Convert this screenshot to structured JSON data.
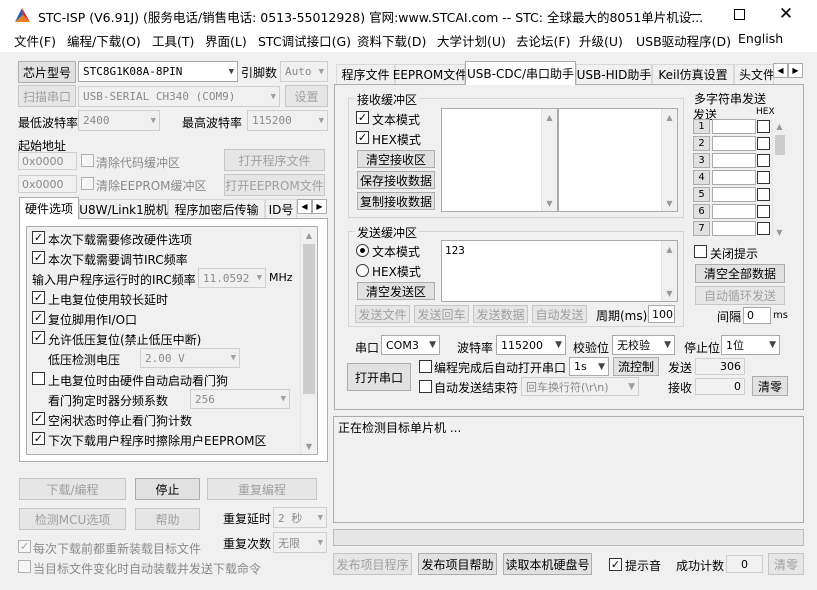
{
  "titlebar": {
    "title": "STC-ISP (V6.91J) (服务电话/销售电话: 0513-55012928) 官网:www.STCAI.com  -- STC: 全球最大的8051单片机设..."
  },
  "menu": [
    "文件(F)",
    "编程/下载(O)",
    "工具(T)",
    "界面(L)",
    "STC调试接口(G)",
    "资料下载(D)",
    "大学计划(U)",
    "去论坛(F)",
    "升级(U)",
    "USB驱动程序(D)",
    "English"
  ],
  "left": {
    "chip_button": "芯片型号",
    "chip_value": "STC8G1K08A-8PIN",
    "pin_label": "引脚数",
    "pin_value": "Auto",
    "scan_button": "扫描串口",
    "port_value": "USB-SERIAL CH340 (COM9)",
    "settings_button": "设置",
    "min_baud_label": "最低波特率",
    "min_baud_value": "2400",
    "max_baud_label": "最高波特率",
    "max_baud_value": "115200",
    "start_addr_label": "起始地址",
    "code_addr": "0x0000",
    "clear_code": "清除代码缓冲区",
    "open_prog": "打开程序文件",
    "eeprom_addr": "0x0000",
    "clear_eeprom": "清除EEPROM缓冲区",
    "open_eeprom": "打开EEPROM文件",
    "tabs": [
      "硬件选项",
      "U8W/Link1脱机",
      "程序加密后传输",
      "ID号"
    ],
    "options": {
      "opt1": "本次下载需要修改硬件选项",
      "opt2": "本次下载需要调节IRC频率",
      "irc_label": "输入用户程序运行时的IRC频率",
      "irc_value": "11.0592",
      "irc_unit": "MHz",
      "opt3": "上电复位使用较长延时",
      "opt4": "复位脚用作I/O口",
      "opt5": "允许低压复位(禁止低压中断)",
      "lv_label": "低压检测电压",
      "lv_value": "2.00 V",
      "opt6": "上电复位时由硬件自动启动看门狗",
      "wdt_label": "看门狗定时器分频系数",
      "wdt_value": "256",
      "opt7": "空闲状态时停止看门狗计数",
      "opt8": "下次下载用户程序时擦除用户EEPROM区"
    },
    "download_button": "下载/编程",
    "stop_button": "停止",
    "reprogram_button": "重复编程",
    "check_mcu_button": "检测MCU选项",
    "help_button": "帮助",
    "repeat_delay_label": "重复延时",
    "repeat_delay_value": "2 秒",
    "repeat_count_label": "重复次数",
    "repeat_count_value": "无限",
    "reload_before": "每次下载前都重新装载目标文件",
    "auto_reload": "当目标文件变化时自动装载并发送下载命令"
  },
  "right": {
    "tabs": [
      "程序文件",
      "EEPROM文件",
      "USB-CDC/串口助手",
      "USB-HID助手",
      "Keil仿真设置",
      "头文件"
    ],
    "recv": {
      "title": "接收缓冲区",
      "text_mode": "文本模式",
      "hex_mode": "HEX模式",
      "clear": "清空接收区",
      "save": "保存接收数据",
      "copy": "复制接收数据"
    },
    "send": {
      "title": "发送缓冲区",
      "text_mode": "文本模式",
      "hex_mode": "HEX模式",
      "clear": "清空发送区",
      "content": "123",
      "send_file": "发送文件",
      "send_enter": "发送回车",
      "send_data": "发送数据",
      "auto_send": "自动发送",
      "period_label": "周期(ms)",
      "period_value": "100"
    },
    "multi": {
      "title": "多字符串发送",
      "send_col": "发送",
      "hex_col": "HEX",
      "rows": [
        "1",
        "2",
        "3",
        "4",
        "5",
        "6",
        "7"
      ],
      "close_tip": "关闭提示",
      "clear_all": "清空全部数据",
      "auto_loop": "自动循环发送",
      "interval_label": "间隔",
      "interval_value": "0",
      "interval_unit": "ms"
    },
    "serial": {
      "port_label": "串口",
      "port_value": "COM3",
      "baud_label": "波特率",
      "baud_value": "115200",
      "parity_label": "校验位",
      "parity_value": "无校验",
      "stop_label": "停止位",
      "stop_value": "1位",
      "open_button": "打开串口",
      "auto_open": "编程完成后自动打开串口",
      "delay_value": "1s",
      "flow_button": "流控制",
      "auto_end": "自动发送结束符",
      "line_end_value": "回车换行符(\\r\\n)",
      "send_label": "发送",
      "send_count": "306",
      "recv_label": "接收",
      "recv_count": "0",
      "clear_button": "清零"
    },
    "status_text": "正在检测目标单片机 ...",
    "bottom": {
      "publish_prog": "发布项目程序",
      "publish_help": "发布项目帮助",
      "read_disk": "读取本机硬盘号",
      "sound_label": "提示音",
      "success_label": "成功计数",
      "success_value": "0",
      "clear_button": "清零"
    }
  }
}
